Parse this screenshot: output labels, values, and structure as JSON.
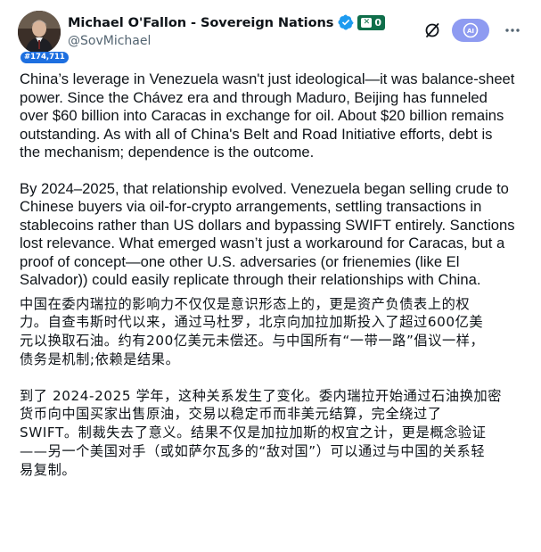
{
  "author": {
    "display_name": "Michael O'Fallon - Sovereign Nations",
    "handle": "@SovMichael",
    "follower_badge": "#174,711",
    "x_badge_count": "0"
  },
  "colors": {
    "verified_blue": "#1d9bf0",
    "badge_blue": "#1d6fe0",
    "x_badge_green": "#0f6e4a",
    "grok_pill": "#8e9bf1",
    "text": "#0f1419",
    "muted": "#536471"
  },
  "icons": {
    "verified": "verified-check-icon",
    "x_badge": "x-logo-icon",
    "action_1": "slash-circle-icon",
    "grok": "grok-ai-icon",
    "more": "more-horizontal-icon"
  },
  "content": {
    "en_para_1": "China’s leverage in Venezuela wasn't just ideological—it was balance-sheet\npower. Since the Chávez era and through Maduro, Beijing has funneled\nover $60 billion into Caracas in exchange for oil. About $20 billion remains\noutstanding. As with all of China's Belt and Road Initiative efforts, debt is\nthe mechanism; dependence is the outcome.",
    "en_para_2": "By 2024–2025, that relationship evolved. Venezuela began selling crude to\nChinese buyers via oil-for-crypto arrangements, settling transactions in\nstablecoins rather than US dollars and bypassing SWIFT entirely. Sanctions\nlost relevance. What emerged wasn’t just a workaround for Caracas, but a\nproof of concept—one other U.S. adversaries (or frienemies (like El\nSalvador)) could easily replicate through their relationships with China.",
    "zh_para_1": "中国在委内瑞拉的影响力不仅仅是意识形态上的，更是资产负债表上的权\n力。自查韦斯时代以来，通过马杜罗，北京向加拉加斯投入了超过600亿美\n元以换取石油。约有200亿美元未偿还。与中国所有“一带一路”倡议一样，\n债务是机制;依赖是结果。",
    "zh_para_2": "到了 2024-2025 学年，这种关系发生了变化。委内瑞拉开始通过石油换加密\n货币向中国买家出售原油，交易以稳定币而非美元结算，完全绕过了\nSWIFT。制裁失去了意义。结果不仅是加拉加斯的权宜之计，更是概念验证\n——另一个美国对手（或如萨尔瓦多的“敌对国”）可以通过与中国的关系轻\n易复制。"
  }
}
